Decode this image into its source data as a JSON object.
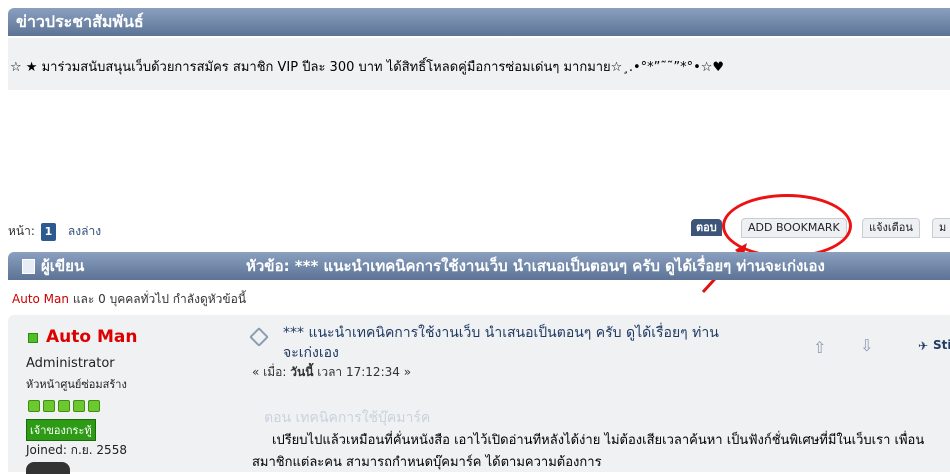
{
  "news": {
    "title": "ข่าวประชาสัมพันธ์",
    "text": "☆ ★ มาร่วมสนับสนุนเว็บด้วยการสมัคร สมาชิก VIP ปีละ 300 บาท ได้สิทธิ์โหลดคู่มือการซ่อมเด่นๆ มากมาย☆¸.•°*”˜˜”*°•☆♥"
  },
  "pager": {
    "label": "หน้า:",
    "current": "1",
    "bottom_link": "ลงล่าง"
  },
  "buttons": {
    "reply": "ตอบ",
    "bookmark": "ADD BOOKMARK",
    "report": "แจ้งเตือน",
    "more": "ม"
  },
  "topic_bar": {
    "author_label": "ผู้เขียน",
    "topic": "หัวข้อ: *** แนะนำเทคนิคการใช้งานเว็บ นำเสนอเป็นตอนๆ ครับ ดูได้เรื่อยๆ ท่านจะเก่งเอง"
  },
  "viewers": {
    "name": "Auto Man",
    "rest": " และ 0 บุคคลทั่วไป กำลังดูหัวข้อนี้"
  },
  "poster": {
    "name": "Auto Man",
    "role": "Administrator",
    "subtitle": "หัวหน้าศูนย์ซ่อมสร้าง",
    "stars": 5,
    "badge": "เจ้าของกระทู้",
    "joined": "Joined: ก.ย. 2558"
  },
  "post": {
    "title": "*** แนะนำเทคนิคการใช้งานเว็บ นำเสนอเป็นตอนๆ ครับ ดูได้เรื่อยๆ ท่านจะเก่งเอง",
    "date_prefix": "« เมื่อ:",
    "date_day": "วันนี้",
    "date_rest": "เวลา 17:12:34 »",
    "sticky": "Sti",
    "section_heading": "ตอน เทคนิคการใช้บุ๊คมาร์ค",
    "body": "เปรียบไปแล้วเหมือนที่คั่นหนังสือ เอาไว้เปิดอ่านทีหลังได้ง่าย ไม่ต้องเสียเวลาค้นหา  เป็นฟังก์ชั่นพิเศษที่มีในเว็บเรา เพื่อนสมาชิกแต่ละคน สามารถกำหนดบุ๊คมาร์ค ได้ตามความต้องการ"
  },
  "colors": {
    "header_bar": "#6f86a8",
    "highlight": "#e11111",
    "online": "#4fbf26",
    "poster_name": "#dd0000"
  }
}
